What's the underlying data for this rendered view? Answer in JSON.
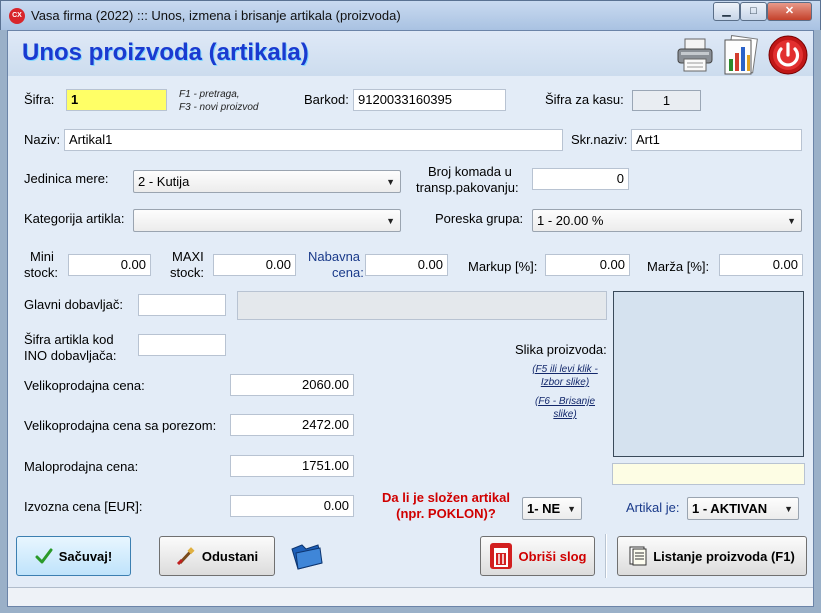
{
  "window": {
    "title": "Vasa firma (2022) ::: Unos, izmena i brisanje artikala (proizvoda)",
    "app_icon_text": "CX"
  },
  "header": {
    "title": "Unos proizvoda (artikala)"
  },
  "fields": {
    "sifra_label": "Šifra:",
    "sifra": "1",
    "hint_line1": "F1 - pretraga,",
    "hint_line2": "F3 - novi proizvod",
    "barkod_label": "Barkod:",
    "barkod": "9120033160395",
    "sifra_kasa_label": "Šifra za kasu:",
    "sifra_kasa": "1",
    "naziv_label": "Naziv:",
    "naziv": "Artikal1",
    "skr_naziv_label": "Skr.naziv:",
    "skr_naziv": "Art1",
    "jedinica_label": "Jedinica mere:",
    "jedinica": "2 - Kutija",
    "broj_komada_line1": "Broj komada u",
    "broj_komada_line2": "transp.pakovanju:",
    "broj_komada": "0",
    "kategorija_label": "Kategorija artikla:",
    "kategorija": "",
    "poreska_label": "Poreska grupa:",
    "poreska": "1 - 20.00 %",
    "mini_line1": "Mini",
    "mini_line2": "stock:",
    "mini": "0.00",
    "maxi_line1": "MAXI",
    "maxi_line2": "stock:",
    "maxi": "0.00",
    "nabavna_line1": "Nabavna",
    "nabavna_line2": "cena:",
    "nabavna": "0.00",
    "markup_label": "Markup [%]:",
    "markup": "0.00",
    "marza_label": "Marža [%]:",
    "marza": "0.00",
    "dobavljac_label": "Glavni dobavljač:",
    "dobavljac_code": "",
    "dobavljac_name": "",
    "ino_line1": "Šifra artikla kod",
    "ino_line2": "INO dobavljača:",
    "ino": "",
    "vp_cena_label": "Velikoprodajna cena:",
    "vp_cena": "2060.00",
    "vp_porez_label": "Velikoprodajna cena sa porezom:",
    "vp_porez": "2472.00",
    "mp_cena_label": "Maloprodajna cena:",
    "mp_cena": "1751.00",
    "izvozna_label": "Izvozna cena [EUR]:",
    "izvozna": "0.00",
    "slozen_line1": "Da li je složen artikal",
    "slozen_line2": "(npr. POKLON)?",
    "slozen": "1- NE",
    "artikal_je_label": "Artikal je:",
    "artikal_je": "1 - AKTIVAN"
  },
  "image": {
    "label": "Slika proizvoda:",
    "link1_line1": "(F5 ili levi klik -",
    "link1_line2": "Izbor slike)",
    "link2_line1": "(F6 - Brisanje",
    "link2_line2": "slike)"
  },
  "buttons": {
    "save": "Sačuvaj!",
    "cancel": "Odustani",
    "delete": "Obriši slog",
    "list": "Listanje proizvoda (F1)"
  },
  "colors": {
    "heading": "#1a3ad0",
    "delete_text": "#d00000",
    "input_highlight": "#ffff66"
  },
  "icons": [
    "printer-icon",
    "chart-report-icon",
    "power-icon",
    "checkmark-icon",
    "brush-icon",
    "folder-icon",
    "trash-icon",
    "list-icon"
  ]
}
